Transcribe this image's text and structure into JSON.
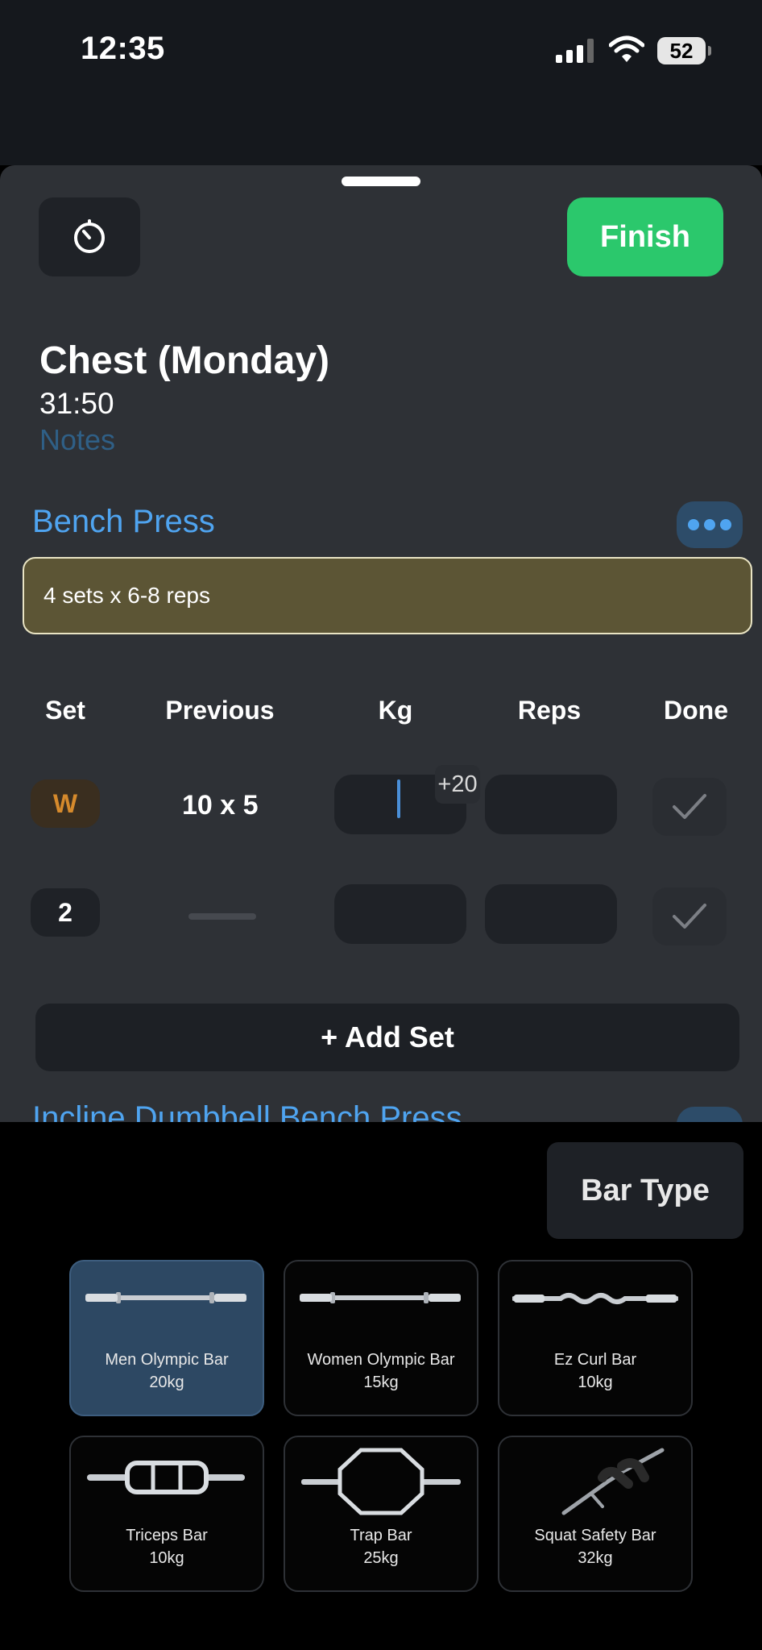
{
  "status_bar": {
    "time": "12:35",
    "battery": "52"
  },
  "workout": {
    "finish_label": "Finish",
    "title": "Chest (Monday)",
    "elapsed": "31:50",
    "notes_placeholder": "Notes"
  },
  "exercise": {
    "name": "Bench Press",
    "note": "4 sets x 6-8 reps",
    "headers": {
      "set": "Set",
      "previous": "Previous",
      "kg": "Kg",
      "reps": "Reps",
      "done": "Done"
    },
    "sets": [
      {
        "set": "W",
        "previous": "10 x 5",
        "kg": "",
        "reps": "",
        "done": false
      },
      {
        "set": "2",
        "previous": "",
        "kg": "",
        "reps": "",
        "done": false
      }
    ],
    "kg_hint": "+20",
    "add_set_label": "+ Add Set"
  },
  "next_exercise_peek": "Incline Dumbbell Bench Press",
  "bar_picker": {
    "title": "Bar Type",
    "selected": "Men Olympic Bar",
    "bars": [
      {
        "name": "Men Olympic Bar",
        "weight": "20kg",
        "icon": "olympic-bar-icon"
      },
      {
        "name": "Women Olympic Bar",
        "weight": "15kg",
        "icon": "olympic-bar-icon"
      },
      {
        "name": "Ez Curl Bar",
        "weight": "10kg",
        "icon": "ez-curl-bar-icon"
      },
      {
        "name": "Triceps Bar",
        "weight": "10kg",
        "icon": "triceps-bar-icon"
      },
      {
        "name": "Trap Bar",
        "weight": "25kg",
        "icon": "trap-bar-icon"
      },
      {
        "name": "Squat Safety Bar",
        "weight": "32kg",
        "icon": "safety-squat-bar-icon"
      }
    ]
  }
}
